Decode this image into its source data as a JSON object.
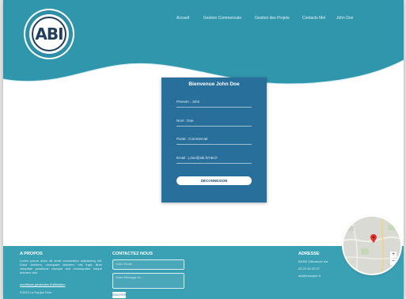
{
  "nav": {
    "items": [
      {
        "label": "Accueil"
      },
      {
        "label": "Gestion Commerciale"
      },
      {
        "label": "Gestion des Projets"
      },
      {
        "label": "Contacts Mel"
      },
      {
        "label": "John Doe"
      }
    ]
  },
  "logo": {
    "text": "ABI"
  },
  "card": {
    "title": "Bienvenue John Doe",
    "fields": {
      "prenom": "Prenom : John",
      "nom": "Nom : Doe",
      "poste": "Poste : Commercial",
      "email": "Email : j.doe@abi.fr/ABI.fr"
    },
    "logout_label": "DÉCONNEXION"
  },
  "footer": {
    "apropos": {
      "title": "A PROPOS",
      "text": "Lorem ipsum dolor sit amet consectetur adipisicing elit. Dolor dolorem, numquam dolorem, nisi fugit, illum voluptate possimus cumque sed consequatur eaque dolorem sint.",
      "link": "conditions generales d'utilisation",
      "copyright": "©2023 La Equipe Dolo"
    },
    "contact": {
      "title": "CONTACTEZ NOUS",
      "email_placeholder": "Votre Email",
      "message_placeholder": "Votre Message ici...",
      "send_label": "ENVOYER"
    },
    "adresse": {
      "title": "ADRESSE",
      "line1": "59000 Villeneuve d'a",
      "line2": "03 20 25 22 07",
      "line3": "abi@example.fr"
    }
  },
  "map": {
    "zoom_in": "+",
    "zoom_out": "−"
  },
  "colors": {
    "primary": "#3aa0b4",
    "card": "#286f9b",
    "dark": "#1f3f5c"
  }
}
